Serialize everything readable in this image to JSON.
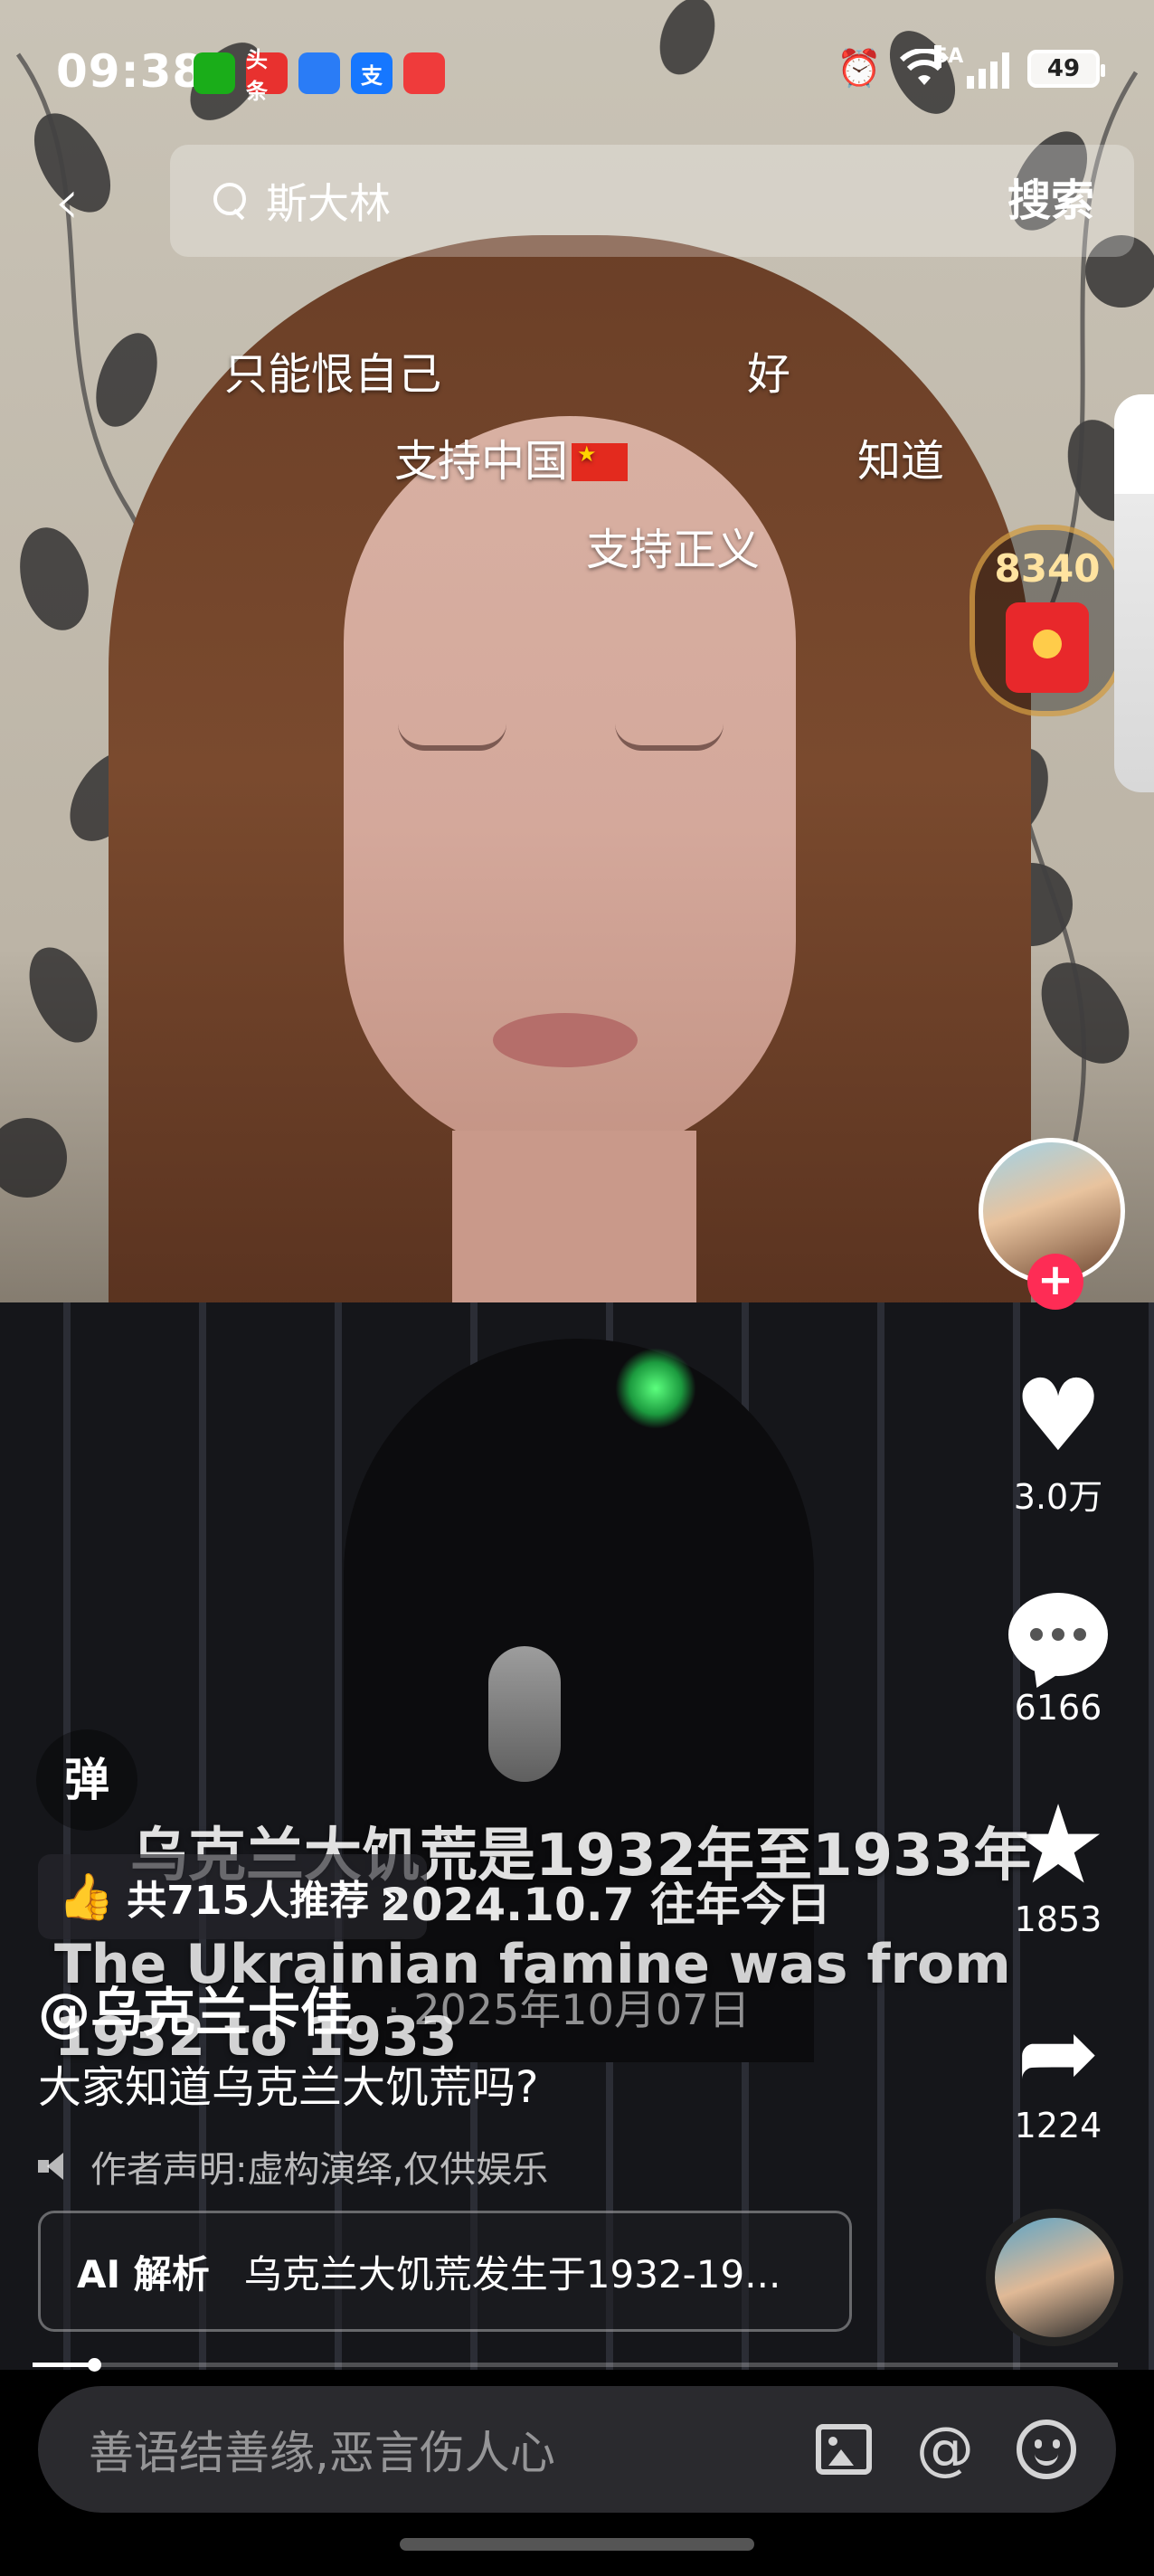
{
  "status_bar": {
    "time": "09:38",
    "app_icons": [
      {
        "name": "wechat-icon",
        "label": "",
        "color": "#1aad19"
      },
      {
        "name": "toutiao-icon",
        "label": "头条",
        "color": "#e8312f"
      },
      {
        "name": "messages-icon",
        "label": "",
        "color": "#2a7cf6"
      },
      {
        "name": "alipay-icon",
        "label": "支",
        "color": "#1677ff"
      },
      {
        "name": "reader-icon",
        "label": "",
        "color": "#ef3b3b"
      }
    ],
    "network": "5A",
    "battery": "49"
  },
  "top_bar": {
    "search_query": "斯大林",
    "search_button": "搜索"
  },
  "danmaku": [
    "只能恨自己",
    "好",
    "支持中国",
    "知道",
    "支持正义"
  ],
  "red_packet": {
    "count": "8340"
  },
  "actions": {
    "likes": "3.0万",
    "comments": "6166",
    "favorites": "1853",
    "shares": "1224"
  },
  "danmu_toggle": "弹",
  "subtitle": {
    "cn": "乌克兰大饥荒是1932年至1933年",
    "en": "The Ukrainian famine was from 1932 to 1933"
  },
  "recommend": {
    "text": "共715人推荐",
    "chevron": "›"
  },
  "date_tag": "2024.10.7 往年今日",
  "author": {
    "name": "@乌克兰卡佳",
    "post_date": "· 2025年10月07日"
  },
  "description": "大家知道乌克兰大饥荒吗?",
  "declaration": "作者声明:虚构演绎,仅供娱乐",
  "ai": {
    "label": "AI 解析",
    "text": "乌克兰大饥荒发生于1932-19..."
  },
  "progress": {
    "fraction": 0.057
  },
  "comment_input": {
    "placeholder": "善语结善缘,恶言伤人心",
    "at": "@"
  },
  "colors": {
    "accent": "#fe2c55",
    "red_packet": "#e8282b"
  }
}
